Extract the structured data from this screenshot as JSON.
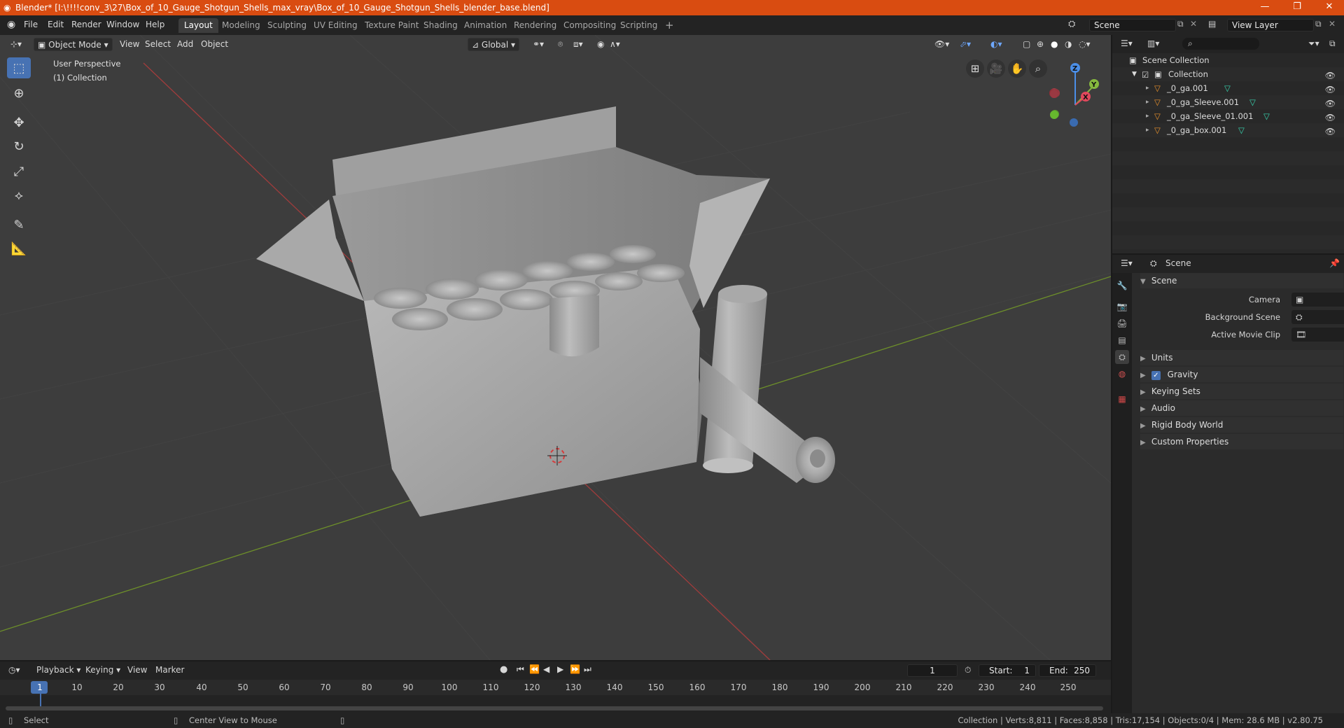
{
  "app": {
    "title": "Blender* [I:\\!!!!conv_3\\27\\Box_of_10_Gauge_Shotgun_Shells_max_vray\\Box_of_10_Gauge_Shotgun_Shells_blender_base.blend]",
    "accent": "#d94c11"
  },
  "menu": [
    "File",
    "Edit",
    "Render",
    "Window",
    "Help"
  ],
  "workspaces": [
    "Layout",
    "Modeling",
    "Sculpting",
    "UV Editing",
    "Texture Paint",
    "Shading",
    "Animation",
    "Rendering",
    "Compositing",
    "Scripting"
  ],
  "active_workspace": "Layout",
  "scene_field": "Scene",
  "view_layer_field": "View Layer",
  "viewport": {
    "mode": "Object Mode",
    "menus": [
      "View",
      "Select",
      "Add",
      "Object"
    ],
    "orientation": "Global",
    "overlay_text": [
      "User Perspective",
      "(1) Collection"
    ],
    "gizmo_axes": [
      "X",
      "Y",
      "Z"
    ]
  },
  "outliner": {
    "root": "Scene Collection",
    "collection": "Collection",
    "items": [
      "_0_ga.001",
      "_0_ga_Sleeve.001",
      "_0_ga_Sleeve_01.001",
      "_0_ga_box.001"
    ]
  },
  "properties": {
    "header": "Scene",
    "panel": "Scene",
    "fields": [
      {
        "label": "Camera"
      },
      {
        "label": "Background Scene"
      },
      {
        "label": "Active Movie Clip"
      }
    ],
    "subpanels": [
      "Units",
      "Gravity",
      "Keying Sets",
      "Audio",
      "Rigid Body World",
      "Custom Properties"
    ],
    "gravity_checked": true
  },
  "timeline": {
    "menus": [
      "Playback",
      "Keying",
      "View",
      "Marker"
    ],
    "current_frame": "1",
    "start_label": "Start:",
    "start": "1",
    "end_label": "End:",
    "end": "250",
    "ticks": [
      "1",
      "10",
      "20",
      "30",
      "40",
      "50",
      "60",
      "70",
      "80",
      "90",
      "100",
      "110",
      "120",
      "130",
      "140",
      "150",
      "160",
      "170",
      "180",
      "190",
      "200",
      "210",
      "220",
      "230",
      "240",
      "250"
    ]
  },
  "status": {
    "left": "Select",
    "middle": "Center View to Mouse",
    "right": "Collection | Verts:8,811 | Faces:8,858 | Tris:17,154 | Objects:0/4 | Mem: 28.6 MB | v2.80.75"
  }
}
